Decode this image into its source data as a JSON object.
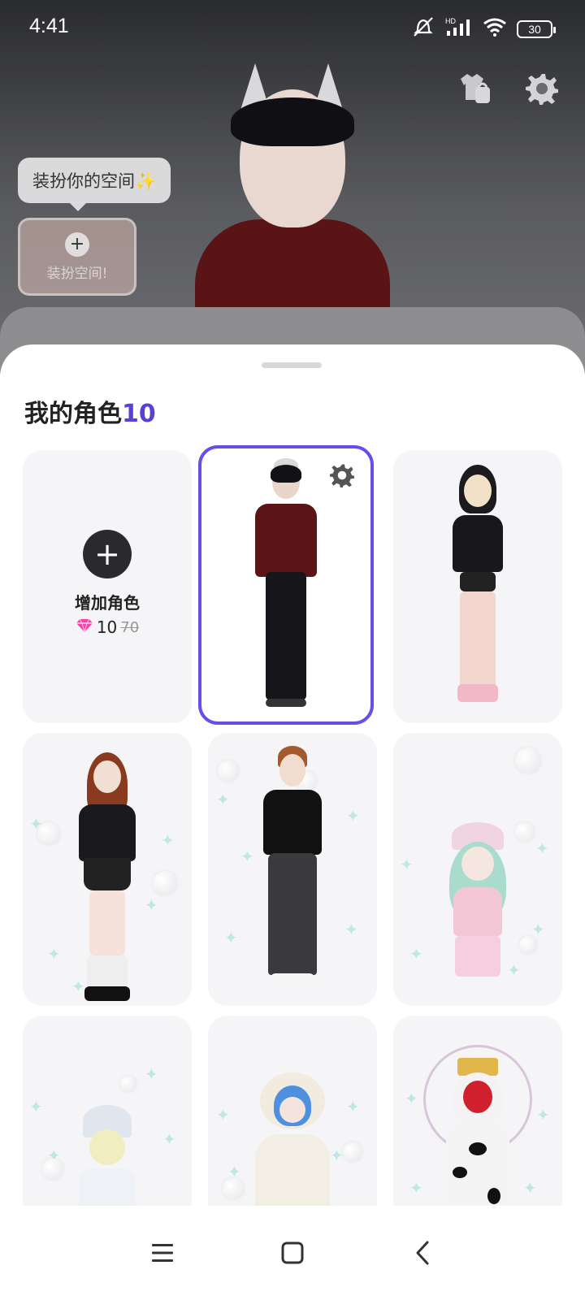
{
  "status_bar": {
    "time": "4:41",
    "signal_label": "HD",
    "battery": "30"
  },
  "scene": {
    "tooltip_text": "装扮你的空间✨",
    "decorate_plus": "+",
    "decorate_label": "装扮空间!",
    "top_icons": [
      "wardrobe-bag-icon",
      "gear-icon"
    ]
  },
  "sheet": {
    "title": "我的角色",
    "count": "10",
    "add_card": {
      "plus": "+",
      "label": "增加角色",
      "price": "10",
      "original_price": "70",
      "currency_icon": "gem-icon"
    },
    "selected_index": 1
  },
  "colors": {
    "accent": "#6a4de8",
    "title_count": "#5a3fd8"
  },
  "nav": [
    "menu-icon",
    "home-icon",
    "back-icon"
  ]
}
